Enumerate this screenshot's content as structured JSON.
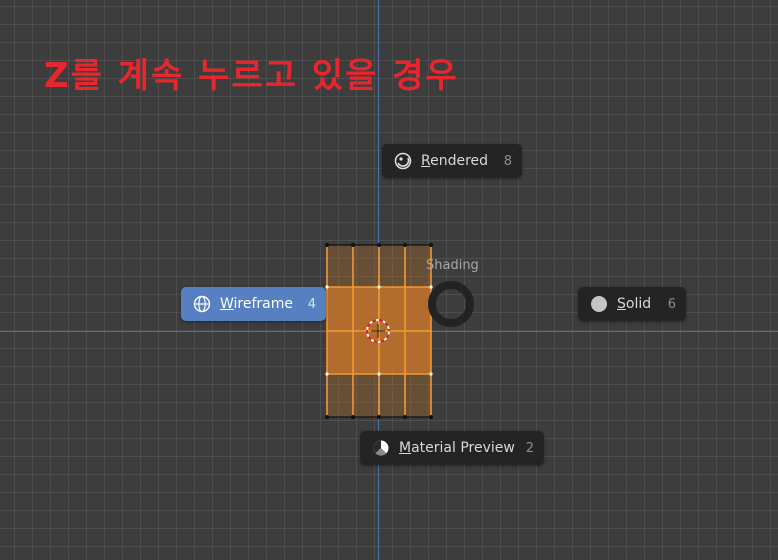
{
  "overlay_title": "Z를 계속 누르고 있을 경우",
  "pie_menu": {
    "title": "Shading",
    "items": [
      {
        "label": "Rendered",
        "key": "8",
        "icon": "rendered-sphere-icon",
        "underline": "R",
        "rest": "endered"
      },
      {
        "label": "Wireframe",
        "key": "4",
        "icon": "wireframe-globe-icon",
        "underline": "W",
        "rest": "ireframe",
        "active": true
      },
      {
        "label": "Solid",
        "key": "6",
        "icon": "solid-sphere-icon",
        "underline": "S",
        "rest": "olid"
      },
      {
        "label": "Material Preview",
        "key": "2",
        "icon": "material-preview-sphere-icon",
        "underline": "M",
        "rest": "aterial Preview"
      }
    ]
  },
  "colors": {
    "active": "#5680c2",
    "x_axis": "#b3474c",
    "y_axis": "#4a74ad",
    "selection": "#f29a2e",
    "title_red": "#e8262e"
  }
}
